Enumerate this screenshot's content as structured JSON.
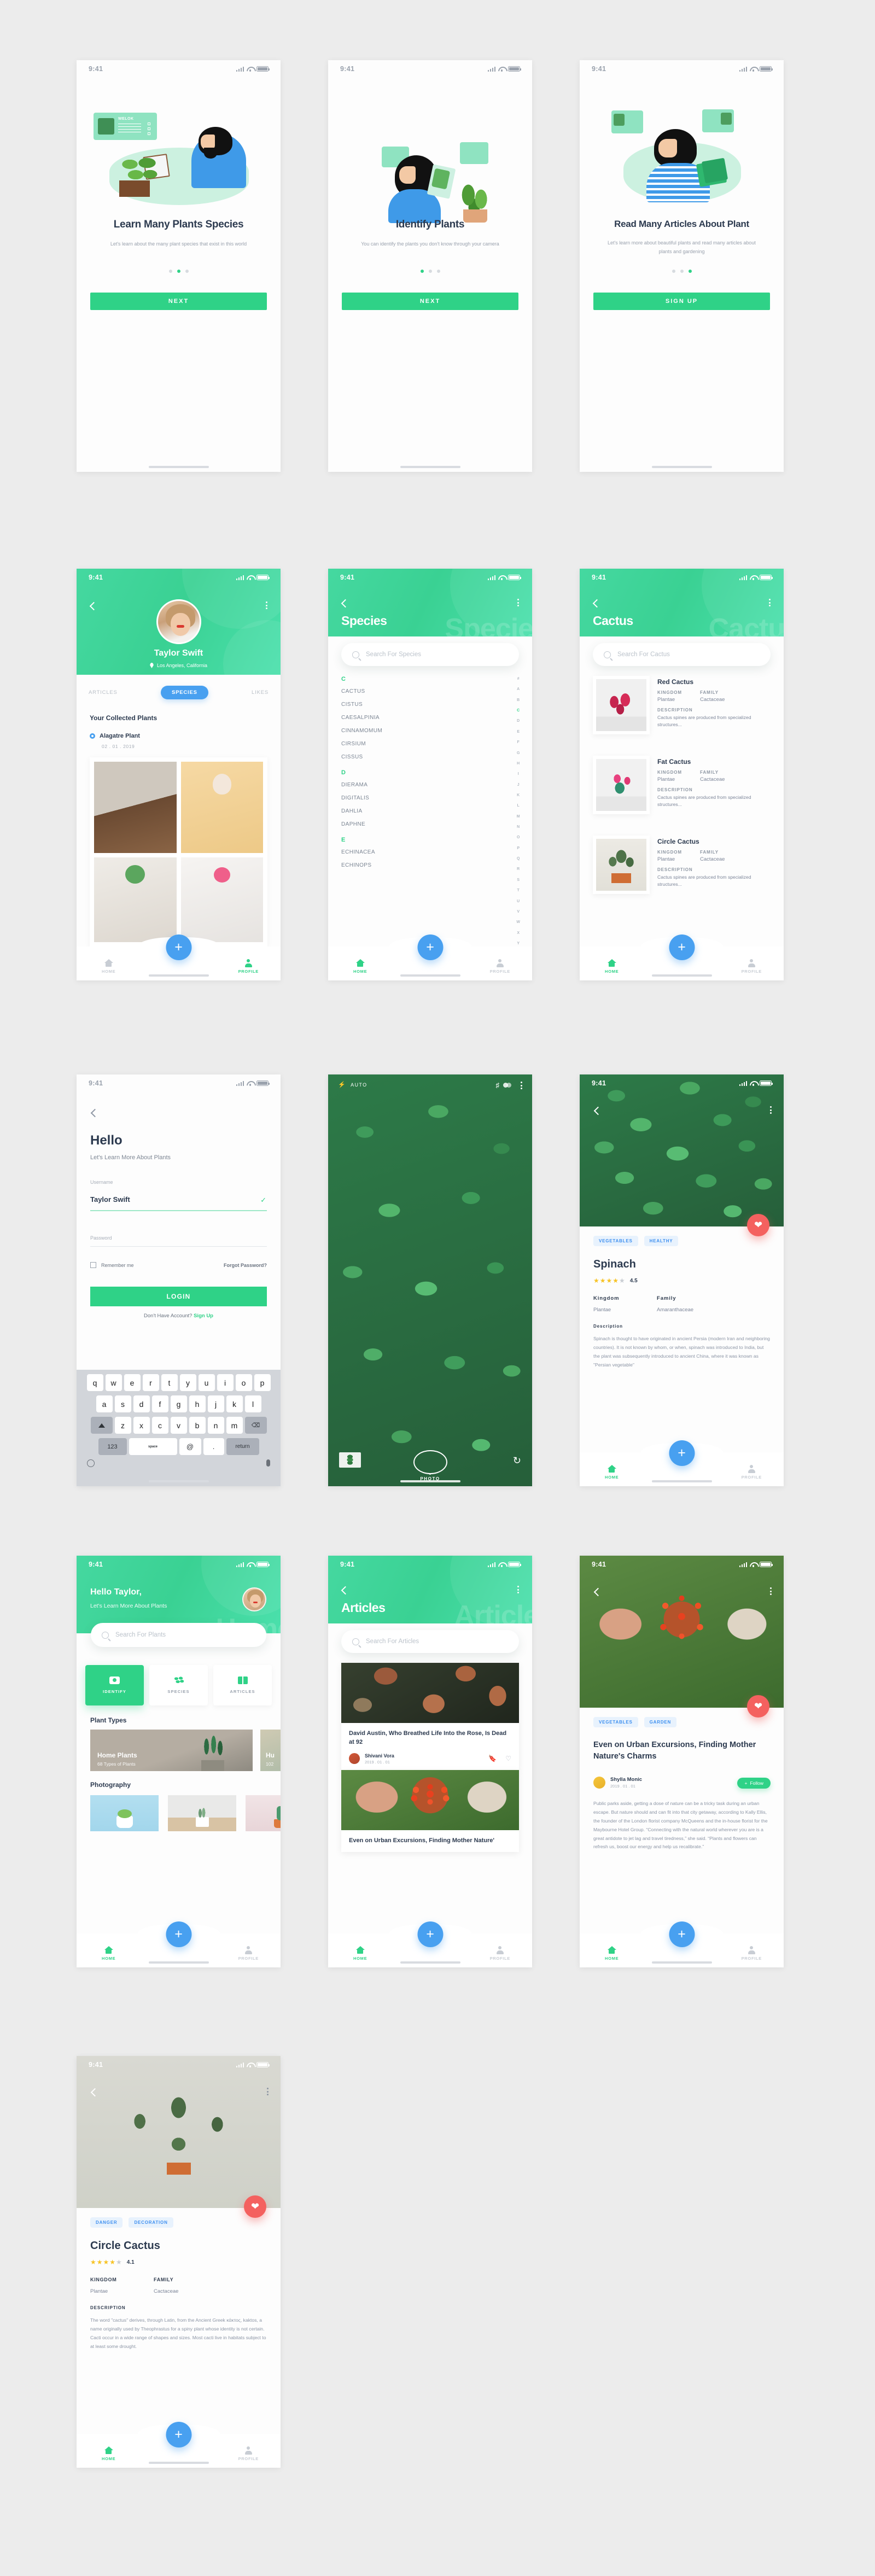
{
  "meta": {
    "status_time": "9:41",
    "accent_green": "#2fd287",
    "accent_blue": "#48a0f0",
    "accent_red": "#f4615f",
    "tag_blue": "#3d8ff0"
  },
  "onboarding": [
    {
      "card_label": "WELOK",
      "title": "Learn Many Plants Species",
      "subtitle": "Let's learn about the many plant species that exist in this world",
      "button": "NEXT",
      "active_dot": 1
    },
    {
      "title": "Identify Plants",
      "subtitle": "You can identify the plants you don't know through your camera",
      "button": "NEXT",
      "active_dot": 0
    },
    {
      "title": "Read Many Articles About Plant",
      "subtitle": "Let's learn more about beautiful plants and read many articles about plants and gardening",
      "button": "SIGN UP",
      "active_dot": 2
    }
  ],
  "profile": {
    "name": "Taylor Swift",
    "location": "Los Angeles, California",
    "location_icon": "map-pin-icon",
    "tabs": [
      "ARTICLES",
      "SPECIES",
      "LIKES"
    ],
    "active_tab": "SPECIES",
    "section_title": "Your Collected Plants",
    "entry_name": "Alagatre Plant",
    "entry_date": "02 . 01 . 2019",
    "nav": {
      "home": "HOME",
      "profile": "PROFILE",
      "active": "PROFILE"
    }
  },
  "species": {
    "title": "Species",
    "ghost_title": "Species",
    "search_placeholder": "Search For Species",
    "groups": [
      {
        "letter": "C",
        "items": [
          "CACTUS",
          "CISTUS",
          "CAESALPINIA",
          "CINNAMOMUM",
          "CIRSIUM",
          "CISSUS"
        ]
      },
      {
        "letter": "D",
        "items": [
          "DIERAMA",
          "DIGITALIS",
          "DAHLIA",
          "DAPHNE"
        ]
      },
      {
        "letter": "E",
        "items": [
          "ECHINACEA",
          "ECHINOPS"
        ]
      }
    ],
    "index": [
      "#",
      "A",
      "B",
      "C",
      "D",
      "E",
      "F",
      "G",
      "H",
      "I",
      "J",
      "K",
      "L",
      "M",
      "N",
      "O",
      "P",
      "Q",
      "R",
      "S",
      "T",
      "U",
      "V",
      "W",
      "X",
      "Y"
    ],
    "index_active": "C",
    "nav": {
      "home": "HOME",
      "profile": "PROFILE",
      "active": "HOME"
    }
  },
  "cactus_list": {
    "title": "Cactus",
    "ghost_title": "Cactus",
    "search_placeholder": "Search For Cactus",
    "col_kingdom": "KINGDOM",
    "col_family": "FAMILY",
    "col_description": "DESCRIPTION",
    "items": [
      {
        "name": "Red Cactus",
        "kingdom": "Plantae",
        "family": "Cactaceae",
        "description": "Cactus spines are produced from specialized structures..."
      },
      {
        "name": "Fat Cactus",
        "kingdom": "Plantae",
        "family": "Cactaceae",
        "description": "Cactus spines are produced from specialized structures..."
      },
      {
        "name": "Circle Cactus",
        "kingdom": "Plantae",
        "family": "Cactaceae",
        "description": "Cactus spines are produced from specialized structures..."
      }
    ],
    "nav": {
      "home": "HOME",
      "profile": "PROFILE",
      "active": "HOME"
    }
  },
  "login": {
    "title": "Hello",
    "subtitle": "Let's Learn More About Plants",
    "username_label": "Username",
    "username_value": "Taylor Swift",
    "password_label": "Password",
    "remember_label": "Remember me",
    "forgot_label": "Forgot Password?",
    "button": "LOGIN",
    "footer_text": "Don't Have Account?",
    "footer_link": "Sign Up",
    "keyboard": {
      "row1": [
        "q",
        "w",
        "e",
        "r",
        "t",
        "y",
        "u",
        "i",
        "o",
        "p"
      ],
      "row2": [
        "a",
        "s",
        "d",
        "f",
        "g",
        "h",
        "j",
        "k",
        "l"
      ],
      "row3": [
        "z",
        "x",
        "c",
        "v",
        "b",
        "n",
        "m"
      ],
      "shift": "shift-icon",
      "backspace": "backspace-icon",
      "num": "123",
      "space": "space",
      "at": "@",
      "dot": ".",
      "return": "return",
      "emoji": "emoji-icon",
      "mic": "microphone-icon"
    }
  },
  "camera": {
    "flash": "AUTO",
    "flash_icon": "flash-icon",
    "grid_icon": "grid-icon",
    "filter_icon": "filter-icon",
    "more_icon": "kebab-icon",
    "mode_label": "PHOTO",
    "gallery_icon": "gallery-thumbnail",
    "flip_icon": "flip-camera-icon",
    "shutter_icon": "shutter-button"
  },
  "spinach": {
    "tags": [
      "VEGETABLES",
      "HEALTHY"
    ],
    "name": "Spinach",
    "rating": "4.5",
    "stars_filled": 4,
    "kingdom_label": "Kingdom",
    "kingdom_value": "Plantae",
    "family_label": "Family",
    "family_value": "Amaranthaceae",
    "description_label": "Description",
    "description": "Spinach is thought to have originated in ancient Persia (modern Iran and neighboring countries). It is not known by whom, or when, spinach was introduced to India, but the plant was subsequently introduced to ancient China, where it was known as \"Persian vegetable\"",
    "like_icon": "heart-icon",
    "nav": {
      "home": "HOME",
      "profile": "PROFILE",
      "active": "HOME"
    }
  },
  "home": {
    "greeting": "Hello Taylor,",
    "subtitle": "Let's Learn More About Plants",
    "ghost_title": "Home",
    "search_placeholder": "Search For Plants",
    "actions": [
      {
        "label": "IDENTIFY",
        "icon": "camera-icon",
        "active": true
      },
      {
        "label": "SPECIES",
        "icon": "leaf-icon",
        "active": false
      },
      {
        "label": "ARTICLES",
        "icon": "book-icon",
        "active": false
      }
    ],
    "plant_types_title": "Plant Types",
    "plant_types": [
      {
        "name": "Home Plants",
        "count": "68 Types of Plants"
      },
      {
        "name": "Hu",
        "count": "102"
      }
    ],
    "photography_title": "Photography",
    "nav": {
      "home": "HOME",
      "profile": "PROFILE",
      "active": "HOME"
    }
  },
  "articles": {
    "title": "Articles",
    "ghost_title": "Articles",
    "search_placeholder": "Search For Articles",
    "items": [
      {
        "title": "David Austin, Who Breathed Life Into the Rose, Is Dead at 92",
        "author": "Shivani Vora",
        "date": "2019 . 01 . 01",
        "bookmark_icon": "bookmark-icon",
        "like_icon": "heart-outline-icon"
      },
      {
        "title": "Even on Urban Excursions, Finding Mother Nature'",
        "author": "",
        "date": ""
      }
    ],
    "nav": {
      "home": "HOME",
      "profile": "PROFILE",
      "active": "HOME"
    }
  },
  "article_detail": {
    "tags": [
      "VEGETABLES",
      "GARDEN"
    ],
    "title": "Even on Urban Excursions, Finding Mother Nature's Charms",
    "author": "Shylla Monic",
    "date": "2019 . 01 . 01",
    "follow_label": "Follow",
    "body": "Public parks aside, getting a dose of nature can be a tricky task during an urban escape. But nature should and can fit into that city getaway, according to Kally Ellis, the founder of the London florist company McQueens and the in-house florist for the Maybourne Hotel Group. “Connecting with the natural world wherever you are is a great antidote to jet lag and travel tiredness,” she said. “Plants and flowers can refresh us, boost our energy and help us recalibrate.”",
    "like_icon": "heart-icon",
    "nav": {
      "home": "HOME",
      "profile": "PROFILE",
      "active": "HOME"
    }
  },
  "circle_cactus": {
    "tags": [
      "DANGER",
      "DECORATION"
    ],
    "name": "Circle Cactus",
    "rating": "4.1",
    "stars_filled": 4,
    "kingdom_label": "KINGDOM",
    "kingdom_value": "Plantae",
    "family_label": "FAMILY",
    "family_value": "Cactaceae",
    "description_label": "DESCRIPTION",
    "description": "The word \"cactus\" derives, through Latin, from the Ancient Greek κάκτος, kaktos, a name originally used by Theophrastus for a spiny plant whose identity is not certain. Cacti occur in a wide range of shapes and sizes. Most cacti live in habitats subject to at least some drought.",
    "like_icon": "heart-icon",
    "nav": {
      "home": "HOME",
      "profile": "PROFILE",
      "active": "HOME"
    }
  }
}
